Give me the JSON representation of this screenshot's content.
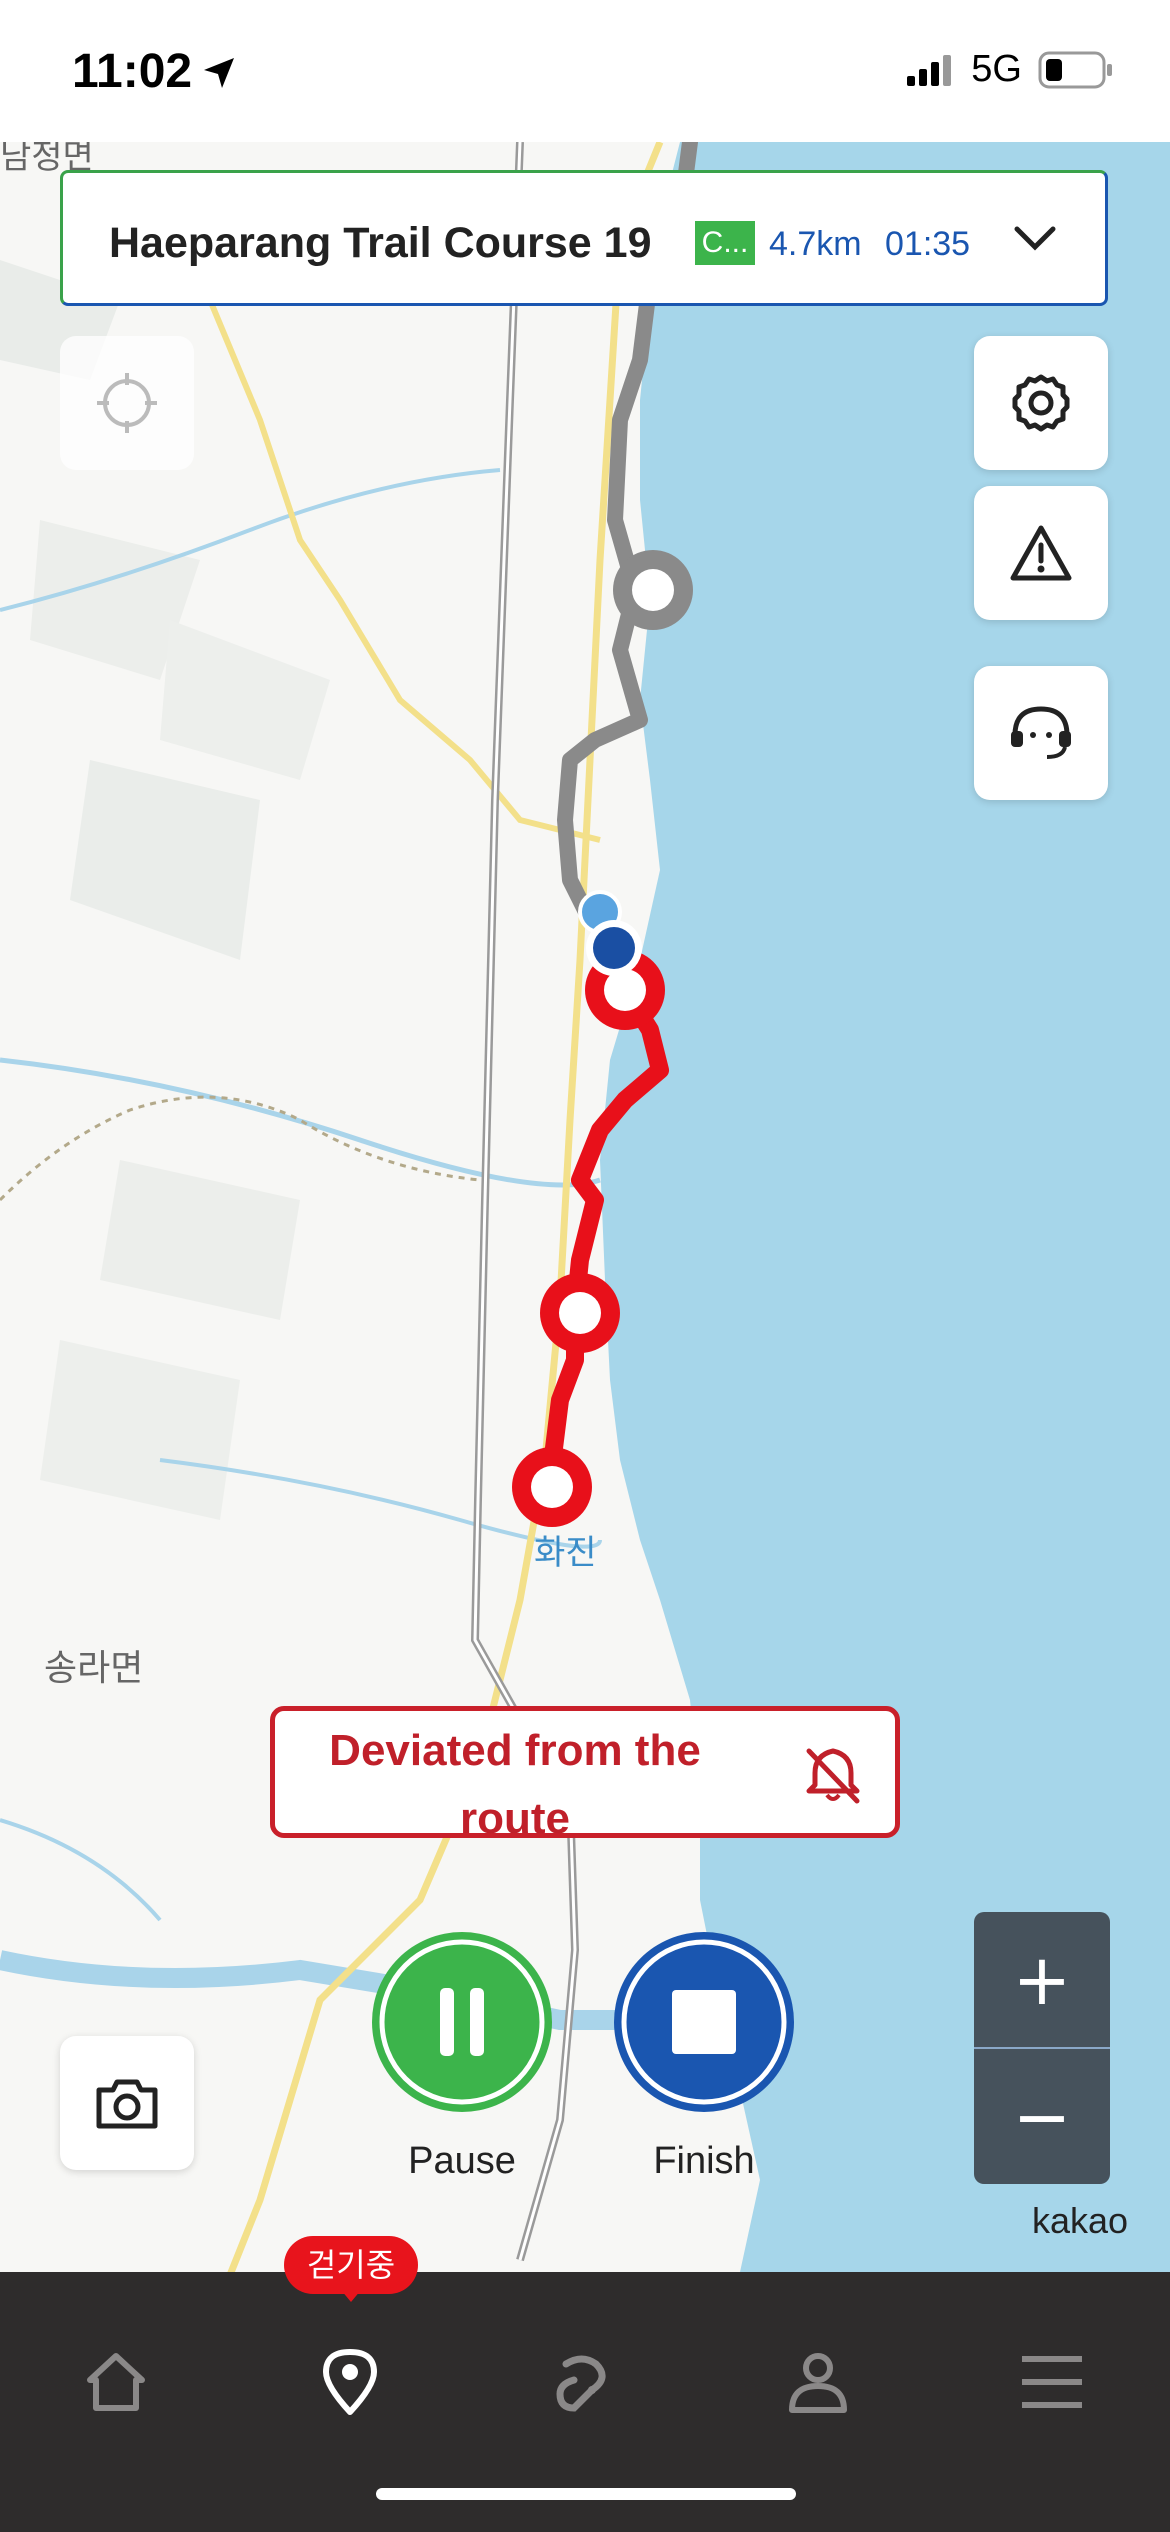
{
  "status_bar": {
    "time": "11:02",
    "network": "5G",
    "icons": [
      "location-arrow-icon",
      "signal-bars-icon",
      "battery-icon"
    ]
  },
  "course_card": {
    "title": "Haeparang Trail Course 19",
    "badge": "C...",
    "distance": "4.7km",
    "duration": "01:35",
    "icons": [
      "chevron-down-icon"
    ]
  },
  "map": {
    "place_labels": [
      "남정면",
      "송라면",
      "화진"
    ],
    "attribution": "kakao",
    "colors": {
      "sea": "#a6d6ea",
      "land": "#f7f7f5",
      "route_done": "#8a8a8a",
      "route_active": "#e8101a",
      "river": "#a9d4ea",
      "road": "#f3e08a"
    }
  },
  "map_controls": {
    "icons": [
      "crosshair-icon",
      "gear-icon",
      "warning-icon",
      "headset-icon",
      "camera-icon"
    ],
    "zoom_in": "+",
    "zoom_out": "−"
  },
  "deviation_banner": {
    "text": "Deviated from the route",
    "icon": "bell-off-icon"
  },
  "controls": {
    "pause_label": "Pause",
    "finish_label": "Finish",
    "pause_color": "#3cb44b",
    "finish_color": "#1a56b0"
  },
  "bottom_nav": {
    "active_badge": "걷기중",
    "items": [
      "home-icon",
      "location-pin-icon",
      "trail-icon",
      "profile-icon",
      "menu-icon"
    ]
  }
}
